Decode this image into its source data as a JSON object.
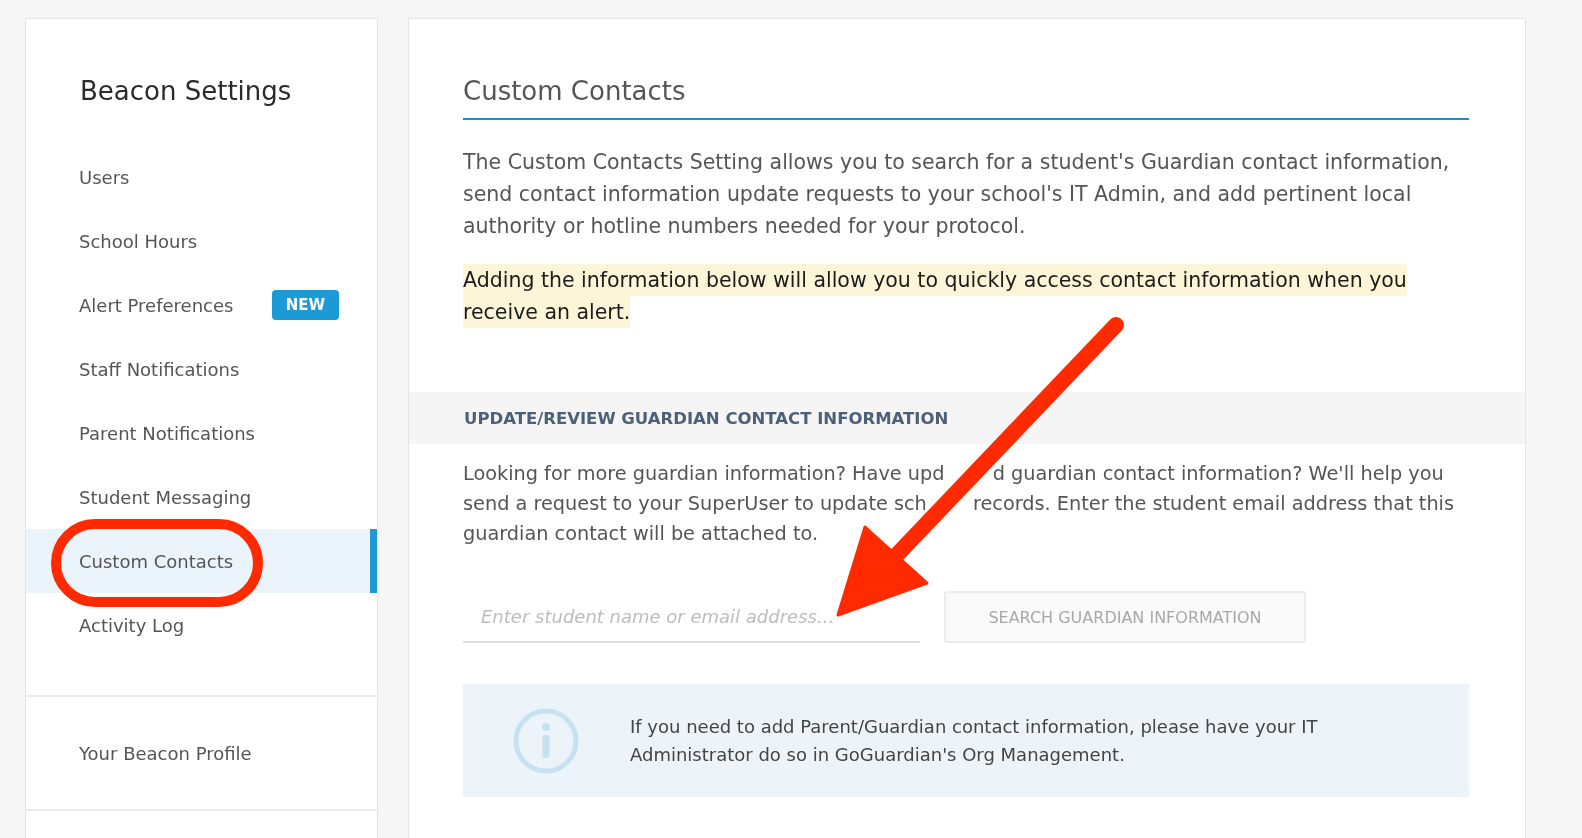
{
  "sidebar": {
    "title": "Beacon Settings",
    "items": [
      {
        "label": "Users",
        "selected": false
      },
      {
        "label": "School Hours",
        "selected": false
      },
      {
        "label": "Alert Preferences",
        "selected": false,
        "badge": "NEW"
      },
      {
        "label": "Staff Notifications",
        "selected": false
      },
      {
        "label": "Parent Notifications",
        "selected": false
      },
      {
        "label": "Student Messaging",
        "selected": false
      },
      {
        "label": "Custom Contacts",
        "selected": true
      },
      {
        "label": "Activity Log",
        "selected": false
      }
    ],
    "profile_link": "Your Beacon Profile"
  },
  "main": {
    "title": "Custom Contacts",
    "intro": "The Custom Contacts Setting allows you to search for a student's Guardian contact information, send contact information update requests to your school's IT Admin, and add pertinent local authority or hotline numbers needed for your protocol.",
    "highlight": "Adding the information below will allow you to quickly access contact information when you receive an alert.",
    "section": {
      "heading": "UPDATE/REVIEW GUARDIAN CONTACT INFORMATION",
      "description": [
        "Looking for more guardian information? Have upd",
        "d guardian contact information? We'll help you send a request to your SuperUser to update sch",
        "records. Enter the student email address that this guardian contact will be attached to."
      ],
      "search": {
        "placeholder": "Enter student name or email address..."
      },
      "search_button": {
        "label": "SEARCH GUARDIAN INFORMATION",
        "disabled": true
      },
      "info": "If you need to add Parent/Guardian contact information, please have your IT Administrator do so in GoGuardian's Org Management."
    }
  }
}
